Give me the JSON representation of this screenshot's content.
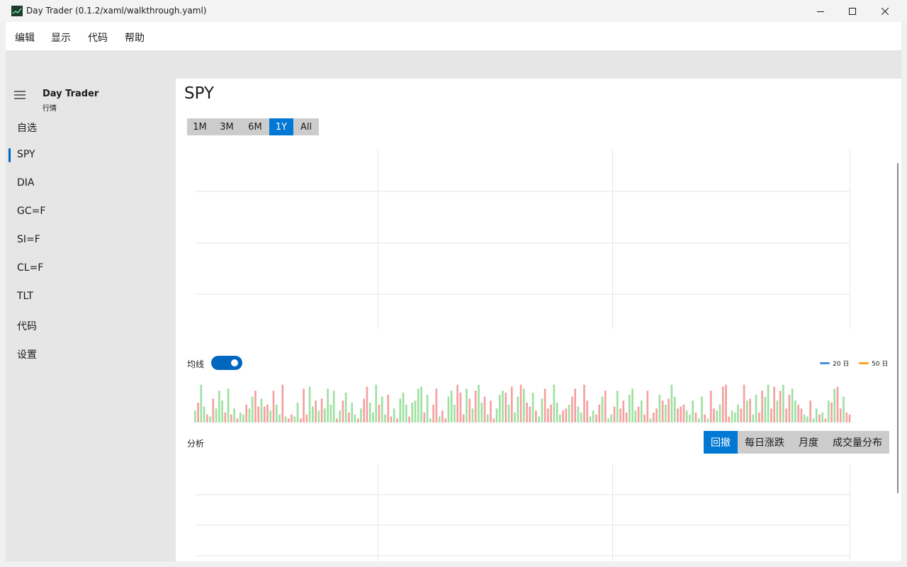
{
  "window": {
    "title": "Day Trader (0.1.2/xaml/walkthrough.yaml)",
    "icon": "chart-app-icon"
  },
  "menu": {
    "items": [
      {
        "label": "编辑"
      },
      {
        "label": "显示"
      },
      {
        "label": "代码"
      },
      {
        "label": "帮助"
      }
    ]
  },
  "sidebar": {
    "title": "Day Trader",
    "subtitle": "行情",
    "items": [
      {
        "label": "自选",
        "selected": false
      },
      {
        "label": "SPY",
        "selected": true
      },
      {
        "label": "DIA",
        "selected": false
      },
      {
        "label": "GC=F",
        "selected": false
      },
      {
        "label": "SI=F",
        "selected": false
      },
      {
        "label": "CL=F",
        "selected": false
      },
      {
        "label": "TLT",
        "selected": false
      },
      {
        "label": "代码",
        "selected": false
      },
      {
        "label": "设置",
        "selected": false
      }
    ]
  },
  "main": {
    "symbol": "SPY",
    "ranges": [
      {
        "label": "1M",
        "active": false
      },
      {
        "label": "3M",
        "active": false
      },
      {
        "label": "6M",
        "active": false
      },
      {
        "label": "1Y",
        "active": true
      },
      {
        "label": "All",
        "active": false
      }
    ],
    "ma_toggle": {
      "label": "均线",
      "on": true
    },
    "legend": [
      {
        "label": "20 日",
        "color": "#4a90e2"
      },
      {
        "label": "50 日",
        "color": "#f5a623"
      }
    ],
    "analysis": {
      "label": "分析",
      "tabs": [
        {
          "label": "回撤",
          "active": true
        },
        {
          "label": "每日涨跌",
          "active": false
        },
        {
          "label": "月度",
          "active": false
        },
        {
          "label": "成交量分布",
          "active": false
        }
      ]
    }
  },
  "colors": {
    "accent": "#0078d4",
    "up": "#9ee0a0",
    "down": "#f4a09e"
  },
  "chart_data": {
    "type": "bar",
    "series": [
      {
        "values": [
          0.3,
          0.5,
          0.95,
          0.4,
          0.2,
          0.15,
          0.6,
          0.35,
          0.8,
          0.55,
          0.25,
          0.85,
          0.2,
          0.35,
          0.1,
          0.25,
          0.2,
          0.45,
          0.35,
          0.65,
          0.8,
          0.4,
          0.6,
          0.4,
          0.45,
          0.3,
          0.8,
          0.45,
          0.2,
          0.95,
          0.15,
          0.1,
          0.2,
          0.15,
          0.5,
          0.1,
          0.85,
          0.2,
          0.9,
          0.4,
          0.55,
          0.3,
          0.6,
          0.35,
          0.85,
          0.45,
          0.8,
          0.1,
          0.3,
          0.55,
          0.75,
          0.25,
          0.5,
          0.2,
          0.1,
          0.35,
          0.6,
          0.9,
          0.5,
          0.25,
          0.95,
          0.45,
          0.65,
          0.2,
          0.7,
          0.15,
          0.35,
          0.1,
          0.6,
          0.75,
          0.45,
          0.15,
          0.5,
          0.55,
          0.85,
          0.9,
          0.25,
          0.7,
          0.1,
          0.45,
          0.85,
          0.15,
          0.3,
          0.1,
          0.65,
          0.8,
          0.45,
          0.95,
          0.75,
          0.2,
          0.85,
          0.6,
          0.35,
          0.8,
          0.95,
          0.5,
          0.65,
          0.2,
          0.55,
          0.1,
          0.35,
          0.7,
          0.8,
          0.75,
          0.45,
          0.9,
          0.25,
          0.65,
          0.95,
          0.85,
          0.5,
          0.4,
          0.75,
          0.3,
          0.15,
          0.6,
          0.85,
          0.35,
          0.45,
          0.95,
          0.5,
          0.2,
          0.3,
          0.35,
          0.45,
          0.65,
          0.85,
          0.4,
          0.25,
          0.95,
          0.55,
          0.15,
          0.3,
          0.2,
          0.45,
          0.65,
          0.8,
          0.1,
          0.2,
          0.4,
          0.8,
          0.35,
          0.55,
          0.25,
          0.7,
          0.85,
          0.3,
          0.4,
          0.55,
          0.2,
          0.8,
          0.1,
          0.25,
          0.35,
          0.7,
          0.55,
          0.45,
          0.6,
          0.95,
          0.65,
          0.35,
          0.4,
          0.45,
          0.3,
          0.2,
          0.55,
          0.25,
          0.1,
          0.65,
          0.2,
          0.1,
          0.8,
          0.35,
          0.3,
          0.45,
          0.9,
          0.95,
          0.15,
          0.3,
          0.25,
          0.45,
          0.35,
          0.95,
          0.55,
          0.6,
          0.2,
          0.7,
          0.25,
          0.8,
          0.65,
          0.95,
          0.35,
          0.9,
          0.55,
          0.8,
          0.95,
          0.35,
          0.7,
          0.85,
          0.55,
          0.45,
          0.35,
          0.2,
          0.15,
          0.55,
          0.1,
          0.35,
          0.2,
          0.25,
          0.1,
          0.55,
          0.5,
          0.85,
          0.9,
          0.35,
          0.65,
          0.25,
          0.2
        ],
        "up": [
          1,
          0,
          1,
          1,
          0,
          1,
          0,
          1,
          1,
          1,
          0,
          1,
          0,
          1,
          0,
          1,
          1,
          0,
          1,
          1,
          0,
          0,
          1,
          0,
          0,
          1,
          0,
          1,
          1,
          0,
          1,
          0,
          0,
          1,
          1,
          0,
          0,
          0,
          1,
          1,
          0,
          1,
          0,
          1,
          1,
          1,
          1,
          0,
          1,
          0,
          1,
          0,
          1,
          1,
          0,
          1,
          0,
          0,
          1,
          1,
          1,
          0,
          1,
          1,
          0,
          0,
          1,
          0,
          1,
          1,
          1,
          0,
          1,
          1,
          1,
          1,
          0,
          1,
          1,
          0,
          0,
          1,
          0,
          0,
          1,
          1,
          1,
          0,
          0,
          0,
          1,
          0,
          1,
          0,
          1,
          1,
          0,
          1,
          0,
          0,
          1,
          1,
          1,
          0,
          1,
          0,
          1,
          1,
          0,
          1,
          0,
          0,
          1,
          0,
          1,
          1,
          0,
          0,
          0,
          1,
          1,
          1,
          0,
          0,
          1,
          0,
          0,
          1,
          1,
          0,
          0,
          1,
          1,
          0,
          0,
          1,
          0,
          1,
          1,
          0,
          1,
          0,
          0,
          0,
          1,
          1,
          1,
          0,
          1,
          0,
          0,
          1,
          0,
          0,
          1,
          0,
          1,
          0,
          1,
          1,
          0,
          0,
          0,
          1,
          1,
          1,
          0,
          1,
          1,
          0,
          1,
          0,
          0,
          1,
          1,
          0,
          0,
          0,
          1,
          1,
          1,
          0,
          0,
          1,
          0,
          1,
          1,
          0,
          0,
          1,
          1,
          0,
          0,
          1,
          0,
          1,
          0,
          0,
          1,
          1,
          0,
          0,
          1,
          1,
          0,
          1,
          1,
          0,
          1,
          0,
          1,
          0,
          1,
          0,
          0,
          1,
          0,
          0,
          1,
          1,
          0,
          1,
          0,
          1
        ]
      }
    ],
    "grid": true,
    "legend": "top-right"
  }
}
